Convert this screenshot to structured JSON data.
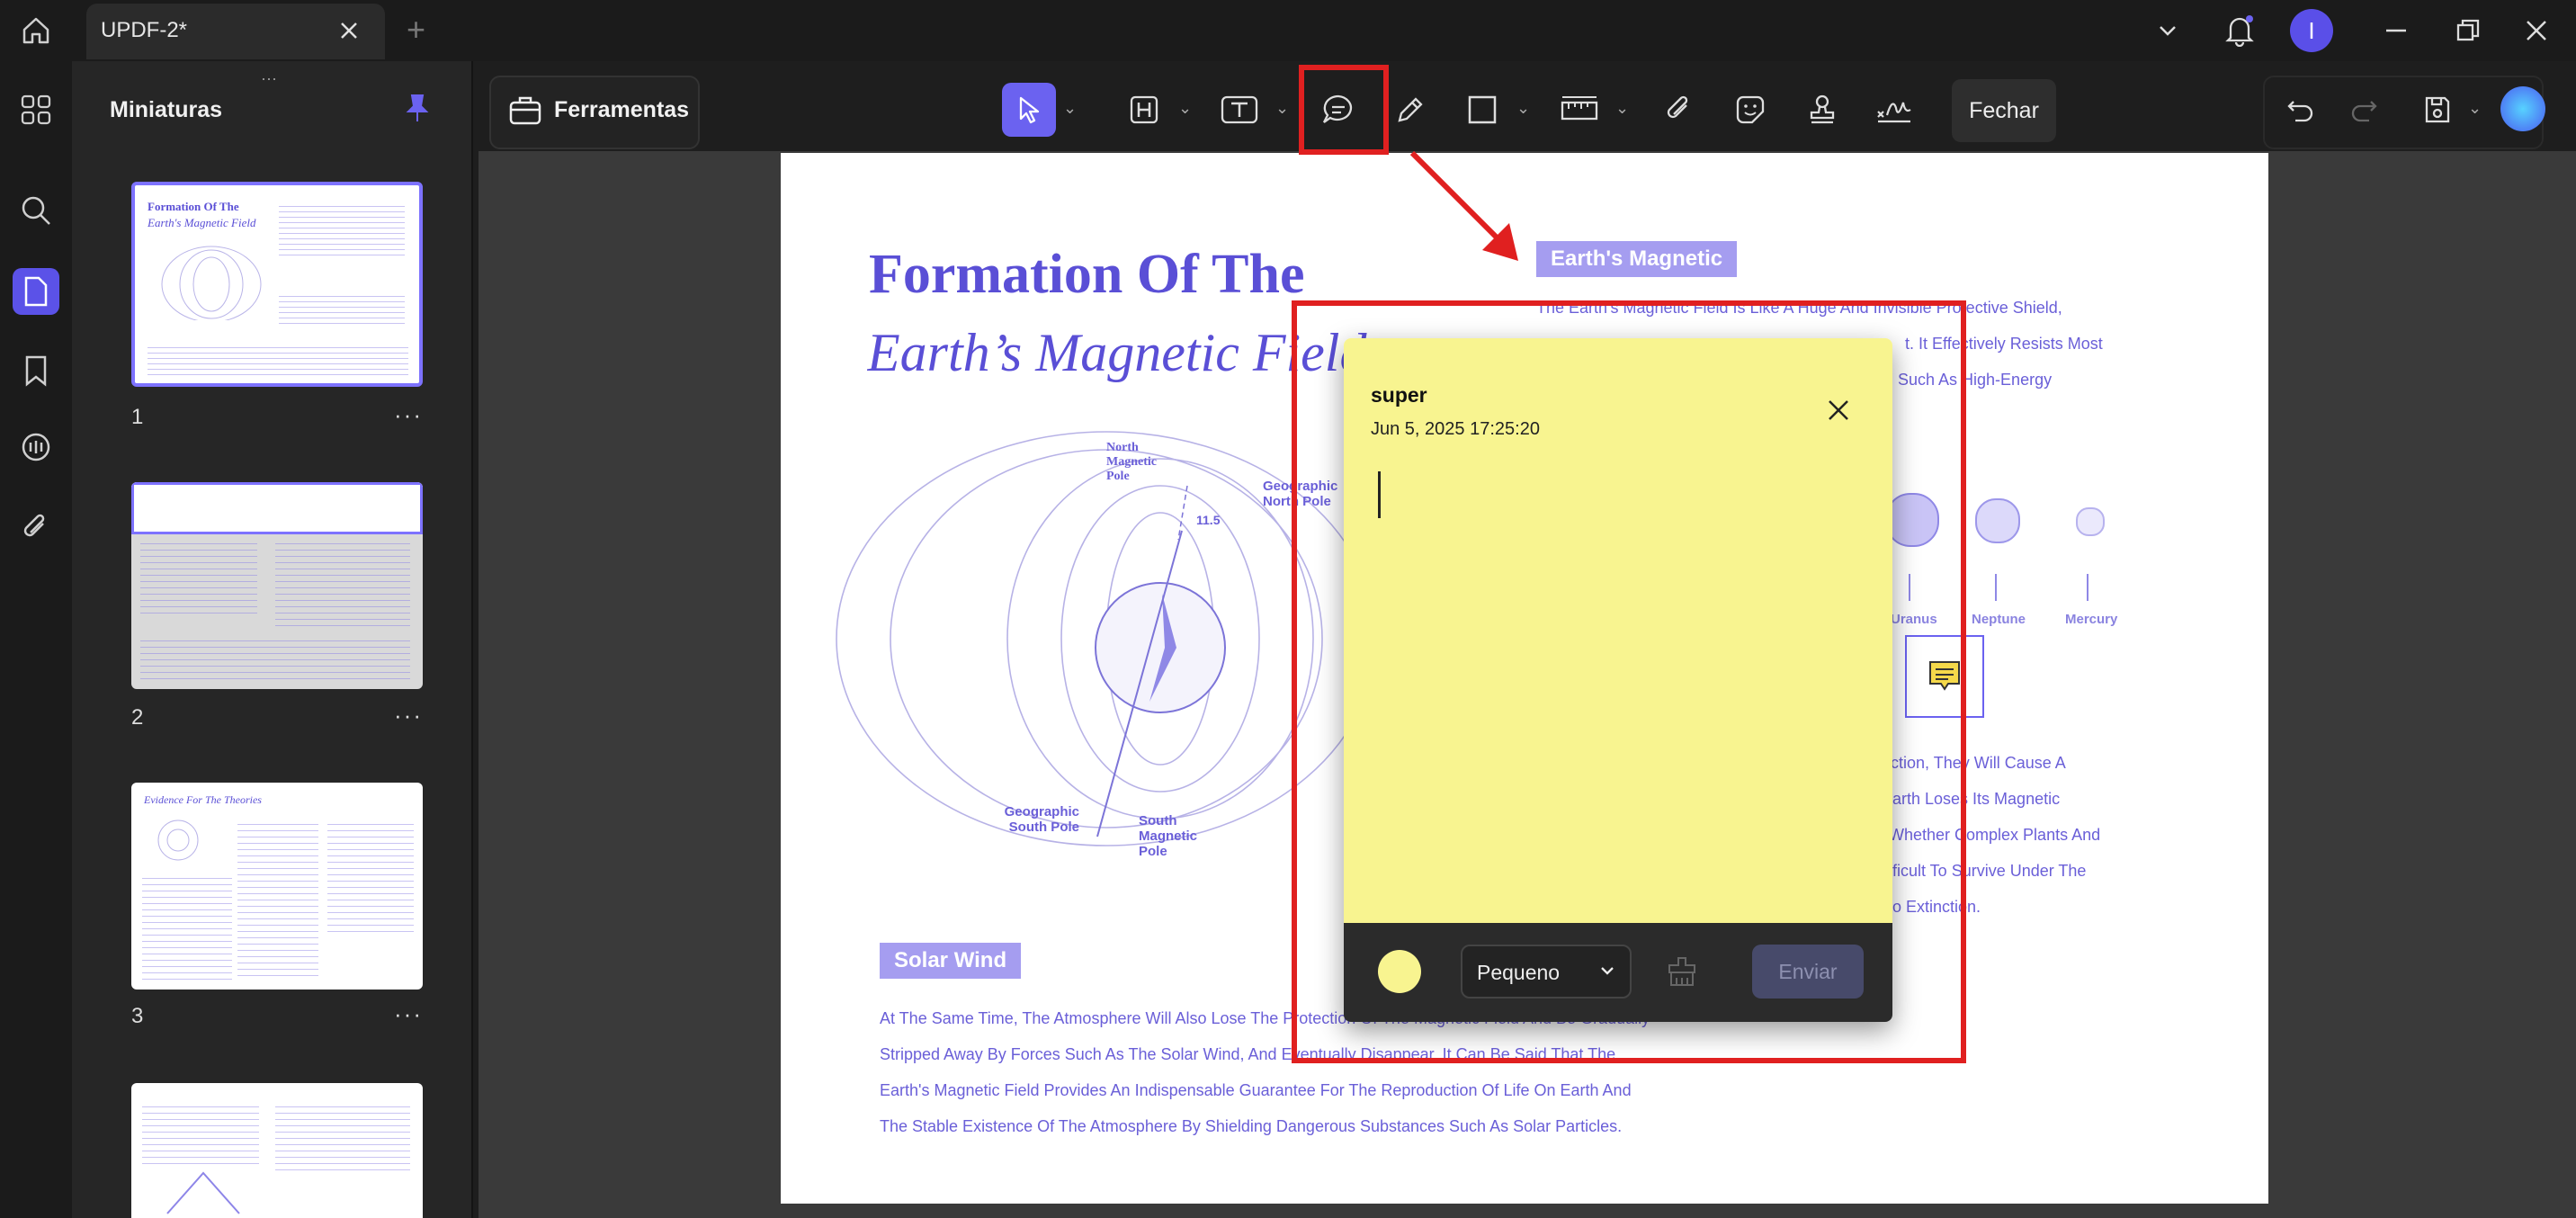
{
  "window": {
    "tab_title": "UPDF-2*",
    "new_tab": "+",
    "avatar_letter": "I"
  },
  "sidebar": {
    "title": "Miniaturas",
    "thumbnails": [
      {
        "page": "1"
      },
      {
        "page": "2"
      },
      {
        "page": "3"
      }
    ],
    "more_label": "···"
  },
  "toolbar": {
    "tools_label": "Ferramentas",
    "close_label": "Fechar"
  },
  "document": {
    "title_line1": "Formation Of The",
    "title_line2": "Earth’s Magnetic Field",
    "section_tag": "Earth's Magnetic",
    "section_lines": [
      "The Earth's Magnetic Field Is Like A Huge And Invisible Protective Shield,",
      "t. It Effectively Resists Most",
      "Such As High-Energy"
    ],
    "diagram_labels": {
      "north_magnetic": "North Magnetic Pole",
      "geographic_north": "Geographic North Pole",
      "geographic_south": "Geographic South Pole",
      "south_magnetic": "South Magnetic Pole",
      "angle": "11.5"
    },
    "planets": [
      "Uranus",
      "Neptune",
      "Mercury"
    ],
    "right_lines": [
      "ction, They Will Cause A",
      "arth Loses Its Magnetic",
      "Whether Complex Plants And",
      "ficult To Survive Under The",
      "o Extinction."
    ],
    "solar_tag": "Solar Wind",
    "bottom_lines": [
      "At The Same Time, The Atmosphere Will Also Lose The Protection Of The Magnetic Field And Be Gradually",
      "Stripped Away By Forces Such As The Solar Wind, And Eventually Disappear. It Can Be Said That The",
      "Earth's Magnetic Field Provides An Indispensable Guarantee For The Reproduction Of Life On Earth And",
      "The Stable Existence Of The Atmosphere By Shielding Dangerous Substances Such As Solar Particles."
    ]
  },
  "note": {
    "author": "super",
    "timestamp": "Jun 5, 2025 17:25:20",
    "size_select": "Pequeno",
    "send_label": "Enviar",
    "color": "#f8f490"
  },
  "colors": {
    "accent": "#6b62f0",
    "highlight": "#e02020",
    "note_yellow": "#f8f490"
  }
}
